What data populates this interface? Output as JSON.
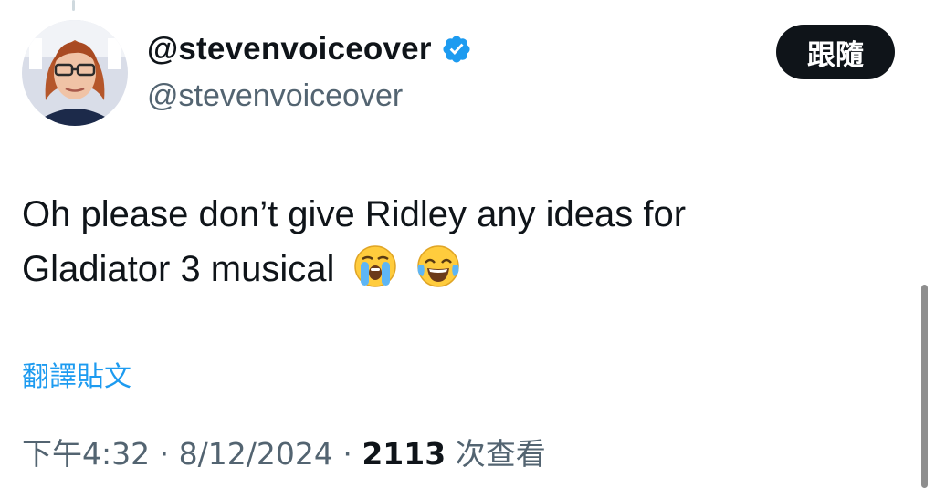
{
  "tweet": {
    "author": {
      "display_name": "@stevenvoiceover",
      "handle": "@stevenvoiceover",
      "verified": true,
      "verified_color": "#1d9bf0"
    },
    "follow_label": "跟隨",
    "text_line1": "Oh please don’t give Ridley any ideas for",
    "text_line2": "Gladiator 3 musical",
    "emojis": [
      "loudly-crying-face",
      "face-with-tears-of-joy"
    ],
    "translate_label": "翻譯貼文",
    "time": "下午4:32",
    "separator": "·",
    "date": "8/12/2024",
    "views_count": "2113",
    "views_label": "次查看"
  }
}
